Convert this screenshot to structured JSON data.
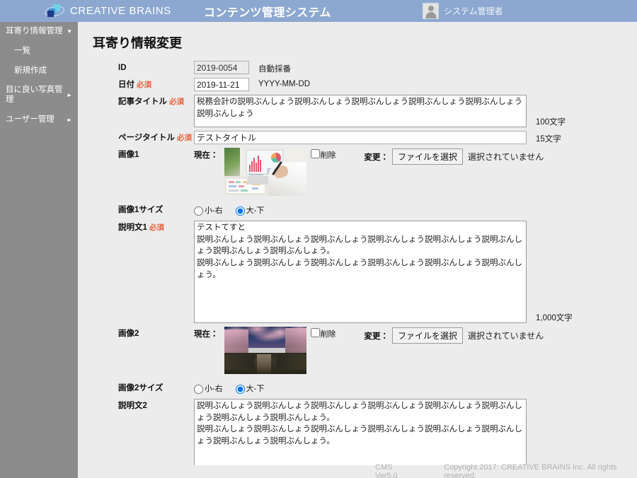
{
  "header": {
    "brand": "CREATIVE BRAINS",
    "app_title": "コンテンツ管理システム",
    "user_name": "システム管理者",
    "bg_color": "#8ca8d0"
  },
  "sidebar": {
    "bg_color": "#8c8c8c",
    "items": [
      {
        "label": "耳寄り情報管理",
        "caret": "▼",
        "sub": false
      },
      {
        "label": "一覧",
        "caret": "",
        "sub": true
      },
      {
        "label": "新規作成",
        "caret": "",
        "sub": true
      },
      {
        "label": "目に良い写真管理",
        "caret": "►",
        "sub": false
      },
      {
        "label": "ユーザー管理",
        "caret": "►",
        "sub": false
      }
    ]
  },
  "main": {
    "page_title": "耳寄り情報変更",
    "required_mark": "必須",
    "fields": {
      "id": {
        "label": "ID",
        "value": "2019-0054",
        "hint": "自動採番"
      },
      "date": {
        "label": "日付",
        "value": "2019-11-21",
        "hint": "YYYY-MM-DD"
      },
      "article_title": {
        "label": "記事タイトル",
        "value": "税務会計の説明ぶんしょう説明ぶんしょう説明ぶんしょう説明ぶんしょう説明ぶんしょう説明ぶんしょう",
        "counter": "100文字"
      },
      "page_title": {
        "label": "ページタイトル",
        "value": "テストタイトル",
        "counter": "15文字"
      },
      "image1": {
        "label": "画像1",
        "current_label": "現在：",
        "delete_label": "削除",
        "change_label": "変更：",
        "file_button": "ファイルを選択",
        "file_status": "選択されていません"
      },
      "image1_size": {
        "label": "画像1サイズ",
        "options": [
          "小-右",
          "大-下"
        ],
        "selected": "大-下"
      },
      "desc1": {
        "label": "説明文1",
        "value": "テストてすと\n説明ぶんしょう説明ぶんしょう説明ぶんしょう説明ぶんしょう説明ぶんしょう説明ぶんしょう説明ぶんしょう説明ぶんしょう。\n説明ぶんしょう説明ぶんしょう説明ぶんしょう説明ぶんしょう説明ぶんしょう説明ぶんしょう。",
        "counter": "1,000文字"
      },
      "image2": {
        "label": "画像2",
        "current_label": "現在：",
        "delete_label": "削除",
        "change_label": "変更：",
        "file_button": "ファイルを選択",
        "file_status": "選択されていません"
      },
      "image2_size": {
        "label": "画像2サイズ",
        "options": [
          "小-右",
          "大-下"
        ],
        "selected": "大-下"
      },
      "desc2": {
        "label": "説明文2",
        "value": "説明ぶんしょう説明ぶんしょう説明ぶんしょう説明ぶんしょう説明ぶんしょう説明ぶんしょう説明ぶんしょう説明ぶんしょう。\n説明ぶんしょう説明ぶんしょう説明ぶんしょう説明ぶんしょう説明ぶんしょう説明ぶんしょう説明ぶんしょう説明ぶんしょう。"
      }
    }
  },
  "footer": {
    "version": "CMS Ver5.0",
    "copyright": "Copyright 2017: CREATIVE BRAINS Inc. All rights reserved."
  }
}
